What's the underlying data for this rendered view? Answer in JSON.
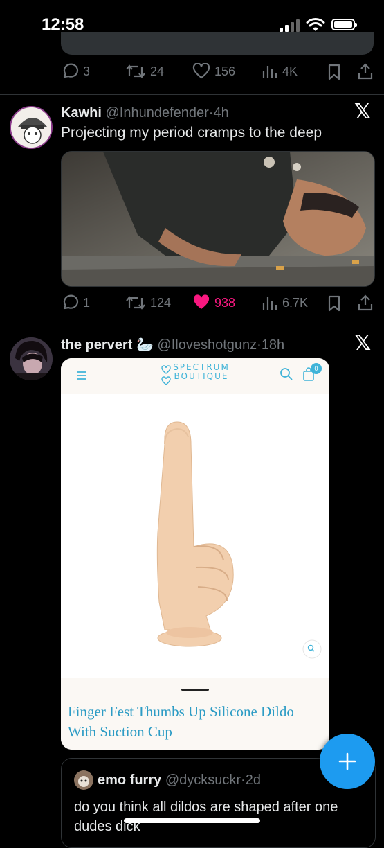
{
  "status_bar": {
    "time": "12:58"
  },
  "previous_tweet": {
    "replies": "3",
    "retweets": "24",
    "likes": "156",
    "views": "4K"
  },
  "tweets": [
    {
      "name": "Kawhi",
      "handle": "@Inhundefender",
      "time": "4h",
      "text": "Projecting my period cramps to the deep",
      "replies": "1",
      "retweets": "124",
      "likes": "938",
      "views": "6.7K",
      "liked_color": "#f91880"
    },
    {
      "name": "the pervert",
      "emoji": "🦢",
      "handle": "@Iloveshotgunz",
      "time": "18h",
      "shop": {
        "logo_line1": "SPECTRUM",
        "logo_line2": "BOUTIQUE",
        "cart_count": "0",
        "product_title": "Finger Fest Thumbs Up Silicone Dildo With Suction Cup"
      },
      "quoted": {
        "name": "emo furry",
        "handle": "@dycksuckr",
        "time": "2d",
        "text": "do you think all dildos are shaped after one dudes dick"
      }
    }
  ],
  "colors": {
    "accent": "#1d9bf0",
    "muted": "#71767b",
    "shop_accent": "#3fb3d8"
  }
}
